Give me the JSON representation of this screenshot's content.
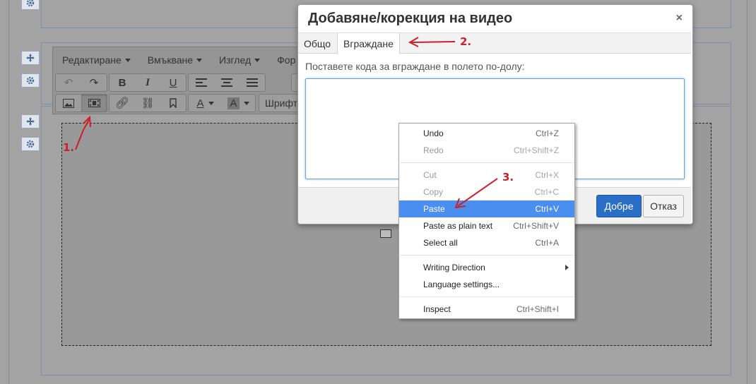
{
  "editor": {
    "menubar": [
      "Редактиране",
      "Вмъкване",
      "Изглед",
      "Фор"
    ],
    "font_label": "Шрифт"
  },
  "dialog": {
    "title": "Добавяне/корекция на видео",
    "close_glyph": "×",
    "tabs": [
      "Общо",
      "Вграждане"
    ],
    "active_tab": "Вграждане",
    "label": "Поставете кода за вграждане в полето по-долу:",
    "textarea_value": "",
    "ok_label": "Добре",
    "cancel_label": "Отказ"
  },
  "context_menu": {
    "items": [
      {
        "label": "Undo",
        "shortcut": "Ctrl+Z",
        "disabled": false
      },
      {
        "label": "Redo",
        "shortcut": "Ctrl+Shift+Z",
        "disabled": true
      },
      {
        "label": "Cut",
        "shortcut": "Ctrl+X",
        "disabled": true
      },
      {
        "label": "Copy",
        "shortcut": "Ctrl+C",
        "disabled": true
      },
      {
        "label": "Paste",
        "shortcut": "Ctrl+V",
        "disabled": false,
        "highlighted": true
      },
      {
        "label": "Paste as plain text",
        "shortcut": "Ctrl+Shift+V",
        "disabled": false
      },
      {
        "label": "Select all",
        "shortcut": "Ctrl+A",
        "disabled": false
      },
      {
        "label": "Writing Direction",
        "shortcut": "",
        "disabled": false,
        "submenu": true
      },
      {
        "label": "Language settings...",
        "shortcut": "",
        "disabled": false
      },
      {
        "label": "Inspect",
        "shortcut": "Ctrl+Shift+I",
        "disabled": false
      }
    ]
  },
  "annotations": [
    "1.",
    "2.",
    "3."
  ],
  "colors": {
    "accent_blue": "#2a6ec7",
    "menu_highlight": "#4a8ff0",
    "annotation_red": "#cc1f2a",
    "overlay_gray": "#a3a3a3"
  }
}
